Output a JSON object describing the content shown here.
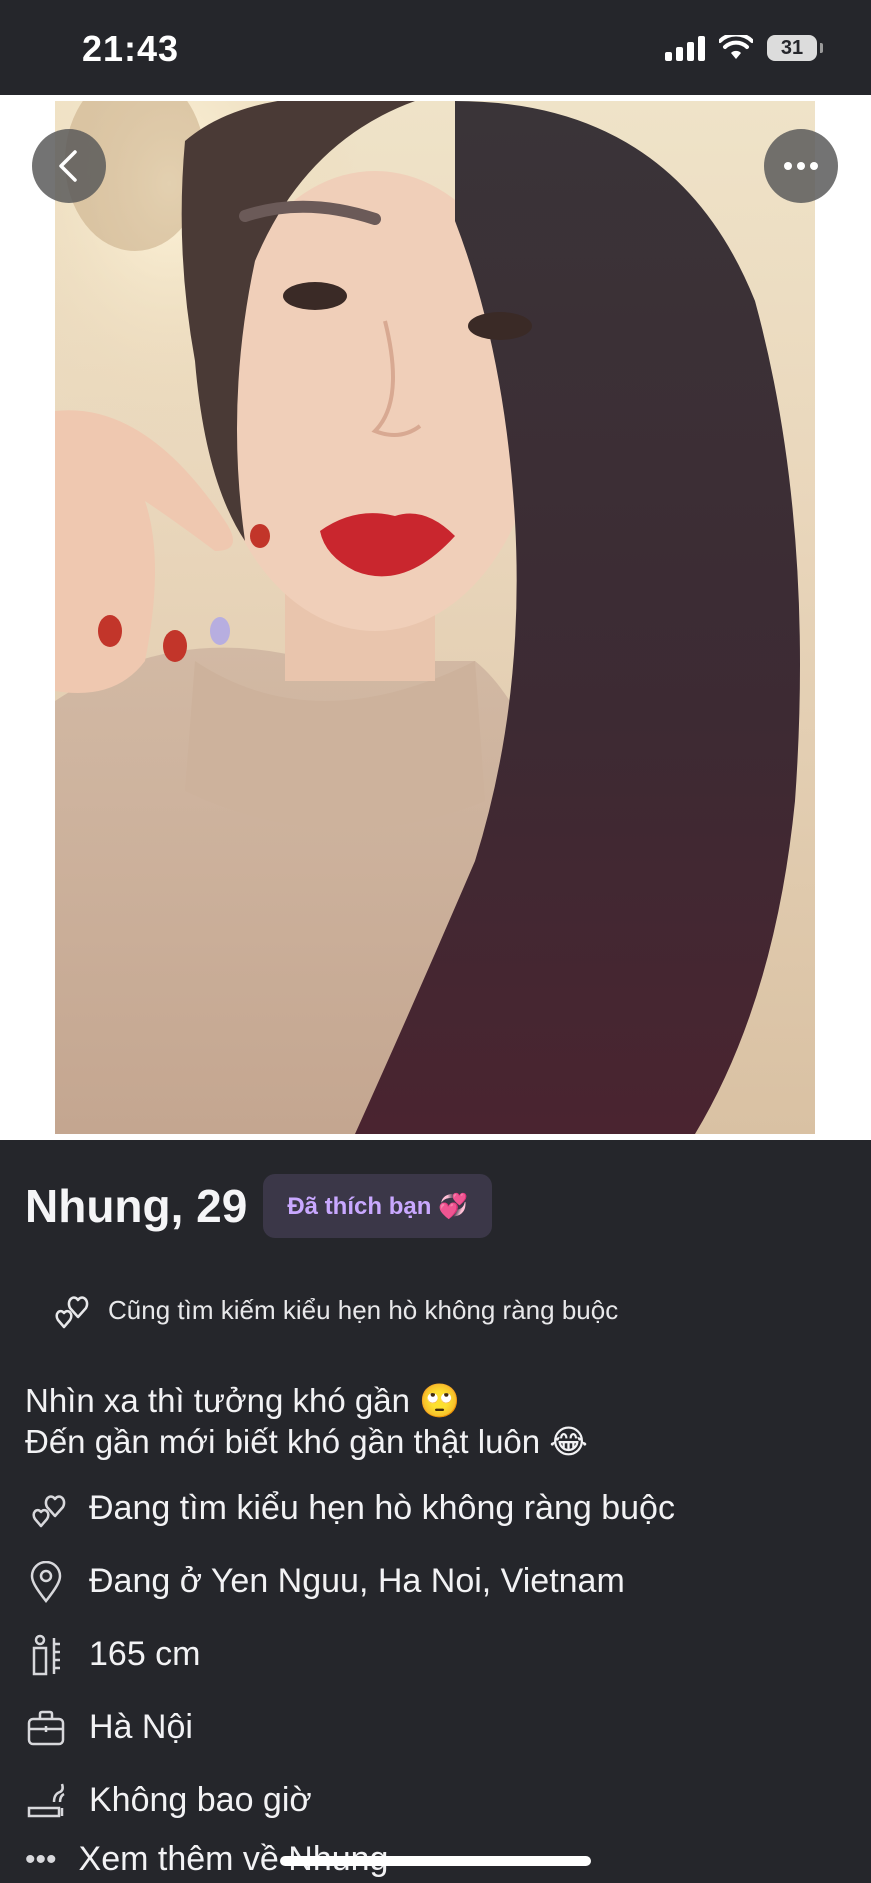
{
  "status_bar": {
    "time": "21:43",
    "battery": "31"
  },
  "profile": {
    "name_age": "Nhung, 29",
    "liked_badge": "Đã thích bạn 💞",
    "also_looking": "Cũng tìm kiếm kiểu hẹn hò không ràng buộc",
    "bio_line1": "Nhìn xa thì tưởng khó gần 🙄",
    "bio_line2": "Đến gần mới biết khó gần thật luôn 😂",
    "details": [
      {
        "icon": "hearts-icon",
        "text": "Đang tìm kiểu hẹn hò không ràng buộc"
      },
      {
        "icon": "location-pin-icon",
        "text": "Đang ở Yen Nguu, Ha Noi, Vietnam"
      },
      {
        "icon": "height-ruler-icon",
        "text": "165 cm"
      },
      {
        "icon": "briefcase-icon",
        "text": "Hà Nội"
      },
      {
        "icon": "smoking-icon",
        "text": "Không bao giờ"
      }
    ],
    "see_more": "Xem thêm về Nhung"
  },
  "colors": {
    "background": "#25262b",
    "badge_bg": "#3b3748",
    "badge_text": "#c9a8ff"
  }
}
